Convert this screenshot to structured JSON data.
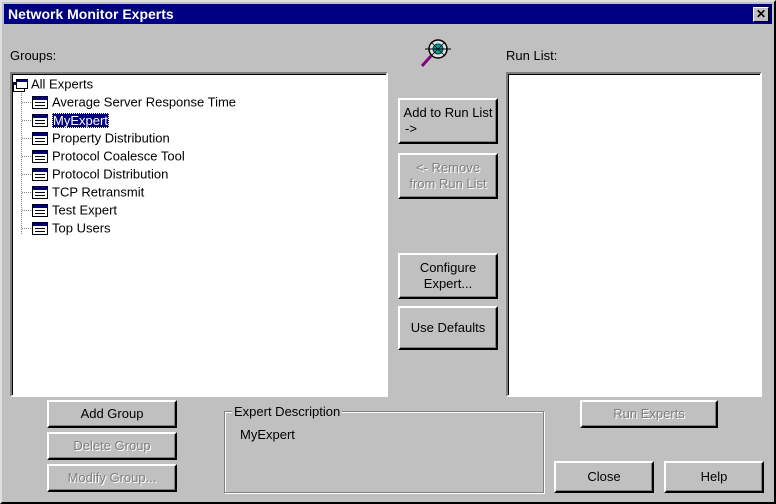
{
  "window": {
    "title": "Network Monitor Experts",
    "close_symbol": "✕"
  },
  "groups": {
    "label": "Groups:",
    "root": "All Experts",
    "items": [
      "Average Server Response Time",
      "MyExpert",
      "Property Distribution",
      "Protocol Coalesce Tool",
      "Protocol Distribution",
      "TCP Retransmit",
      "Test Expert",
      "Top Users"
    ],
    "selected": "MyExpert"
  },
  "run_list": {
    "label": "Run List:"
  },
  "buttons": {
    "add_to_run_list_line1": "Add to Run List",
    "add_to_run_list_line2": "->",
    "remove_line1": "<- Remove",
    "remove_line2": "from Run List",
    "configure_line1": "Configure",
    "configure_line2": "Expert...",
    "use_defaults": "Use Defaults",
    "add_group": "Add Group",
    "delete_group": "Delete Group",
    "modify_group": "Modify Group...",
    "run_experts": "Run Experts",
    "close": "Close",
    "help": "Help"
  },
  "description": {
    "legend": "Expert Description",
    "text": "MyExpert"
  },
  "icons": {
    "expert_logo": "magnifier-expert-icon"
  },
  "colors": {
    "titlebar": "#000080",
    "face": "#c0c0c0",
    "selection": "#000080"
  }
}
